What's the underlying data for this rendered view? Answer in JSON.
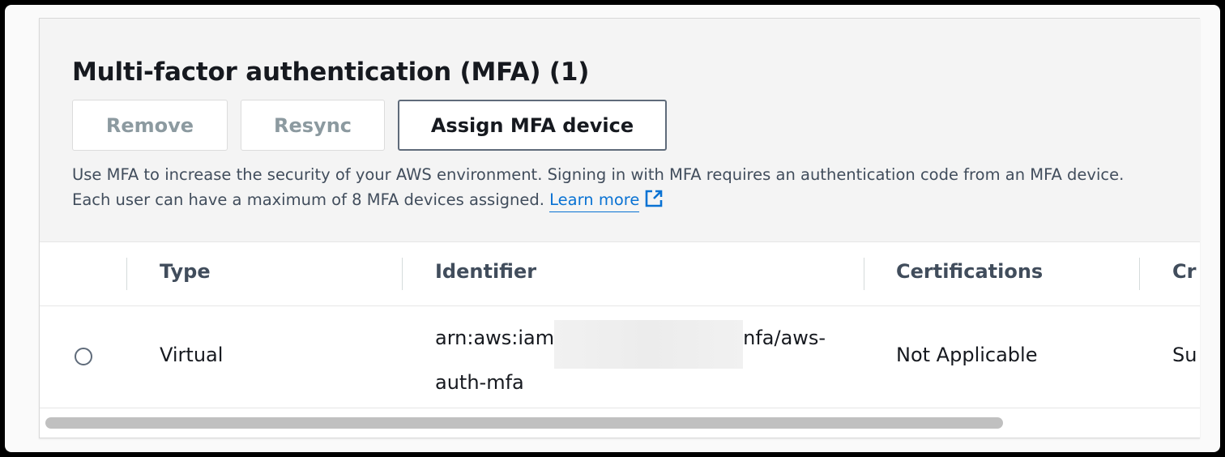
{
  "mfa_section": {
    "title": "Multi-factor authentication (MFA) (1)",
    "buttons": {
      "remove": "Remove",
      "resync": "Resync",
      "assign": "Assign MFA device"
    },
    "description": "Use MFA to increase the security of your AWS environment. Signing in with MFA requires an authentication code from an MFA device. Each user can have a maximum of 8 MFA devices assigned.",
    "learn_more": "Learn more"
  },
  "table": {
    "columns": [
      "Type",
      "Identifier",
      "Certifications",
      "Cr"
    ],
    "rows": [
      {
        "type": "Virtual",
        "identifier_line1_start": "arn:aws:iam",
        "identifier_line1_end": "nfa/aws-",
        "identifier_line2": "auth-mfa",
        "certifications": "Not Applicable",
        "created": "Su"
      }
    ]
  },
  "colors": {
    "link": "#0972d3",
    "disabled_text": "#8c9aa0",
    "heading": "#16191f"
  },
  "icons": {
    "external_link": "external-link-icon"
  }
}
